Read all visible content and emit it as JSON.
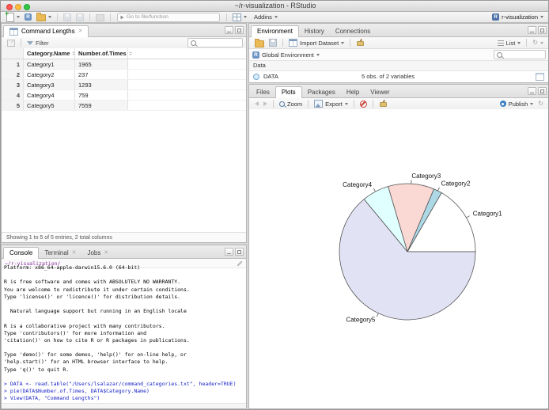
{
  "window": {
    "title": "~/r-visualization - RStudio",
    "project": "r-visualization"
  },
  "toolbar": {
    "goto_placeholder": "Go to file/function",
    "addins": "Addins"
  },
  "viewer": {
    "tab": "Command Lengths",
    "filter": "Filter",
    "columns": [
      "Category.Name",
      "Number.of.Times"
    ],
    "rows": [
      {
        "n": "1",
        "name": "Category1",
        "times": "1965"
      },
      {
        "n": "2",
        "name": "Category2",
        "times": "237"
      },
      {
        "n": "3",
        "name": "Category3",
        "times": "1293"
      },
      {
        "n": "4",
        "name": "Category4",
        "times": "759"
      },
      {
        "n": "5",
        "name": "Category5",
        "times": "7559"
      }
    ],
    "footer": "Showing 1 to 5 of 5 entries, 2 total columns"
  },
  "console": {
    "tabs": [
      "Console",
      "Terminal",
      "Jobs"
    ],
    "working_dir": "~/r-visualization/",
    "lines": [
      "Platform: x86_64-apple-darwin15.6.0 (64-bit)",
      "",
      "R is free software and comes with ABSOLUTELY NO WARRANTY.",
      "You are welcome to redistribute it under certain conditions.",
      "Type 'license()' or 'licence()' for distribution details.",
      "",
      "  Natural language support but running in an English locale",
      "",
      "R is a collaborative project with many contributors.",
      "Type 'contributors()' for more information and",
      "'citation()' on how to cite R or R packages in publications.",
      "",
      "Type 'demo()' for some demos, 'help()' for on-line help, or",
      "'help.start()' for an HTML browser interface to help.",
      "Type 'q()' to quit R.",
      "",
      "> DATA <- read.table(\"/Users/lsalazar/command_categories.txt\", header=TRUE)",
      "> pie(DATA$Number.of.Times, DATA$Category.Name)",
      "> View(DATA, \"Command Lengths\")",
      ">"
    ]
  },
  "environment": {
    "tabs": [
      "Environment",
      "History",
      "Connections"
    ],
    "import_dataset": "Import Dataset",
    "list": "List",
    "scope": "Global Environment",
    "section": "Data",
    "objects": [
      {
        "name": "DATA",
        "summary": "5 obs. of 2 variables"
      }
    ]
  },
  "plots": {
    "tabs": [
      "Files",
      "Plots",
      "Packages",
      "Help",
      "Viewer"
    ],
    "active_tab": "Plots",
    "zoom": "Zoom",
    "export": "Export",
    "publish": "Publish"
  },
  "chart_data": {
    "type": "pie",
    "categories": [
      "Category1",
      "Category2",
      "Category3",
      "Category4",
      "Category5"
    ],
    "values": [
      1965,
      237,
      1293,
      759,
      7559
    ],
    "colors": [
      "#FFFFFF",
      "#ADD8E6",
      "#FAD9D4",
      "#E0FFFF",
      "#E2E2F5"
    ],
    "border_color": "#4d4d4d",
    "start_angle": 0,
    "direction": "counterclockwise",
    "legend": "none",
    "title": ""
  },
  "colors": {
    "command_text": "#1722c4",
    "mac_dots": [
      "#fc5753",
      "#fdbc40",
      "#33c748"
    ],
    "publish_icon": "#3e82c4"
  },
  "icons": {
    "search": "magnifier",
    "filter": "funnel",
    "clear": "broom",
    "new_file": "page-plus",
    "open": "folder",
    "save": "floppy",
    "remove_plot": "ban-circle",
    "publish": "blue-dot",
    "refresh": "circular-arrow"
  }
}
